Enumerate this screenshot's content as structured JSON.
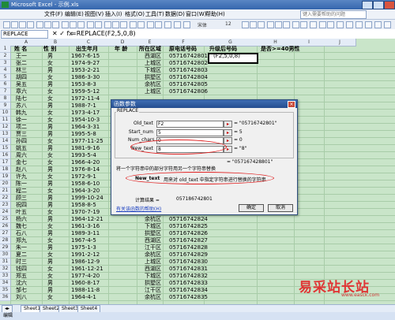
{
  "window": {
    "title": "Microsoft Excel - 示例.xls"
  },
  "menu": {
    "items": [
      "文件(F)",
      "编辑(E)",
      "视图(V)",
      "插入(I)",
      "格式(O)",
      "工具(T)",
      "数据(D)",
      "窗口(W)",
      "帮助(H)"
    ],
    "help_placeholder": "键入需要帮助的问题"
  },
  "toolbar": {
    "font": "宋体",
    "size": "12"
  },
  "formula_bar": {
    "name_box": "REPLACE",
    "fx": "✕ ✓ fx",
    "formula": "=REPLACE(F2,5,0,8)"
  },
  "columns": [
    "A",
    "B",
    "C",
    "D",
    "E",
    "F",
    "G",
    "H",
    "I",
    "J"
  ],
  "headers": [
    "姓 名",
    "性 别",
    "出生年月",
    "年 龄",
    "所在区域",
    "原电话号码",
    "升级后号码",
    "是否>=40男性"
  ],
  "rows": [
    [
      "王一",
      "男",
      "1967-6-15",
      "",
      "西湖区",
      "05716742801",
      "(F2,5,0,8)"
    ],
    [
      "张二",
      "女",
      "1974-9-27",
      "",
      "上城区",
      "05716742802",
      ""
    ],
    [
      "林三",
      "男",
      "1953-2-21",
      "",
      "下城区",
      "05716742803",
      ""
    ],
    [
      "胡四",
      "女",
      "1986-3-30",
      "",
      "拱墅区",
      "05716742804",
      ""
    ],
    [
      "吴五",
      "男",
      "1953-8-3",
      "",
      "余杭区",
      "05716742805",
      ""
    ],
    [
      "章六",
      "女",
      "1959-5-12",
      "",
      "上城区",
      "05716742806",
      ""
    ],
    [
      "陆七",
      "女",
      "1972-11-4",
      "",
      "",
      "",
      ""
    ],
    [
      "苏八",
      "男",
      "1988-7-1",
      "",
      "",
      "",
      ""
    ],
    [
      "韩九",
      "女",
      "1973-4-17",
      "",
      "",
      "",
      ""
    ],
    [
      "徐一",
      "女",
      "1954-10-3",
      "",
      "",
      "",
      ""
    ],
    [
      "项二",
      "男",
      "1964-3-31",
      "",
      "",
      "",
      ""
    ],
    [
      "贾三",
      "男",
      "1995-5-8",
      "",
      "",
      "",
      ""
    ],
    [
      "孙四",
      "女",
      "1977-11-25",
      "",
      "",
      "",
      ""
    ],
    [
      "姚五",
      "男",
      "1981-9-16",
      "",
      "",
      "",
      ""
    ],
    [
      "周六",
      "女",
      "1993-5-4",
      "",
      "",
      "",
      ""
    ],
    [
      "金七",
      "女",
      "1966-4-20",
      "",
      "",
      "",
      ""
    ],
    [
      "赵八",
      "男",
      "1976-8-14",
      "",
      "",
      "",
      ""
    ],
    [
      "许九",
      "女",
      "1972-9-1",
      "",
      "",
      "",
      ""
    ],
    [
      "陈一",
      "男",
      "1958-6-10",
      "",
      "",
      "",
      ""
    ],
    [
      "程二",
      "女",
      "1964-3-20",
      "",
      "",
      "",
      ""
    ],
    [
      "顾三",
      "男",
      "1999-10-24",
      "",
      "",
      "",
      ""
    ],
    [
      "祝四",
      "男",
      "1958-8-5",
      "",
      "",
      "",
      ""
    ],
    [
      "叶五",
      "女",
      "1970-7-19",
      "",
      "",
      "",
      ""
    ],
    [
      "杨六",
      "男",
      "1964-12-21",
      "",
      "余杭区",
      "05716742824",
      ""
    ],
    [
      "魏七",
      "女",
      "1961-3-16",
      "",
      "下城区",
      "05716742825",
      ""
    ],
    [
      "石八",
      "男",
      "1989-3-11",
      "",
      "拱墅区",
      "05716742826",
      ""
    ],
    [
      "郑九",
      "女",
      "1967-4-5",
      "",
      "西湖区",
      "05716742827",
      ""
    ],
    [
      "朱一",
      "男",
      "1975-1-3",
      "",
      "江干区",
      "05716742828",
      ""
    ],
    [
      "夏二",
      "女",
      "1991-2-12",
      "",
      "余杭区",
      "05716742829",
      ""
    ],
    [
      "时三",
      "男",
      "1986-12-9",
      "",
      "上城区",
      "05716742830",
      ""
    ],
    [
      "钱四",
      "女",
      "1961-12-21",
      "",
      "西湖区",
      "05716742831",
      ""
    ],
    [
      "郑五",
      "女",
      "1977-4-20",
      "",
      "下城区",
      "05716742832",
      ""
    ],
    [
      "沈六",
      "男",
      "1960-8-17",
      "",
      "拱墅区",
      "05716742833",
      ""
    ],
    [
      "邹七",
      "男",
      "1988-11-8",
      "",
      "江干区",
      "05716742834",
      ""
    ],
    [
      "刘八",
      "女",
      "1964-4-1",
      "",
      "余杭区",
      "05716742835",
      ""
    ]
  ],
  "dialog": {
    "title": "函数参数",
    "group": "REPLACE",
    "args": [
      {
        "label": "Old_text",
        "value": "F2",
        "result": "= \"05716742801\""
      },
      {
        "label": "Start_num",
        "value": "5",
        "result": "= 5"
      },
      {
        "label": "Num_chars",
        "value": "0",
        "result": "= 0"
      },
      {
        "label": "New_text",
        "value": "8",
        "result": "= \"8\""
      }
    ],
    "result_line": "= \"057167428801\"",
    "description": "将一个字符串中的部分字符用另一个字符串替换",
    "arg_help_name": "New_text",
    "arg_help_text": "用来对 old_text 中指定字符串进行替换的字符串",
    "calc_label": "计算结果 =",
    "calc_value": "057186742801",
    "help_link": "有关该函数的帮助(H)",
    "ok": "确定",
    "cancel": "取消"
  },
  "sheets": [
    "Sheet1",
    "Sheet2",
    "Sheet3",
    "Sheet4"
  ],
  "status": "编辑",
  "watermark": {
    "text": "易采站长站",
    "url": "www.easck.com"
  }
}
